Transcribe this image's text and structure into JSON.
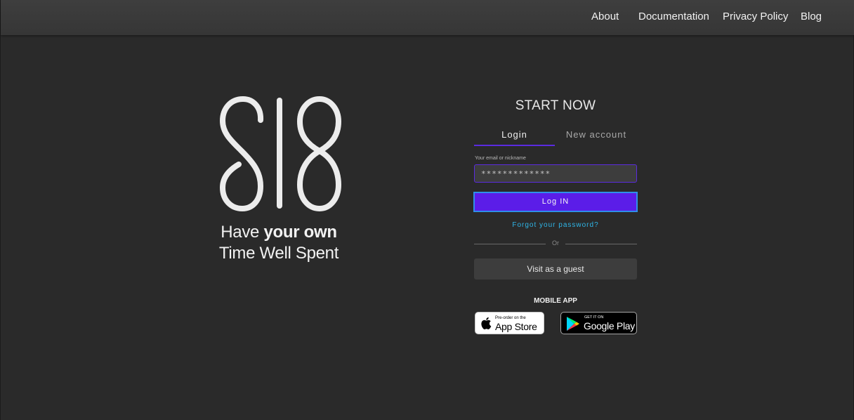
{
  "nav": {
    "about": "About",
    "documentation": "Documentation",
    "privacy": "Privacy Policy",
    "blog": "Blog"
  },
  "brand": {
    "logo_text": "SI8",
    "tagline_prefix": "Have ",
    "tagline_bold": "your own",
    "tagline_line2": "Time Well Spent"
  },
  "form": {
    "title": "START NOW",
    "tabs": {
      "login": "Login",
      "new_account": "New account"
    },
    "email_label": "Your email or nickname",
    "email_value": "*************",
    "login_button": "Log IN",
    "forgot": "Forgot your password?",
    "divider": "Or",
    "guest_button": "Visit as a guest"
  },
  "mobile": {
    "title": "MOBILE APP",
    "apple_small": "Pre-order on the",
    "apple_big": "App Store",
    "google_small": "GET IT ON",
    "google_big": "Google Play"
  },
  "colors": {
    "background": "#2a2a2a",
    "accent": "#5b1de8",
    "link": "#2fb6e8"
  }
}
